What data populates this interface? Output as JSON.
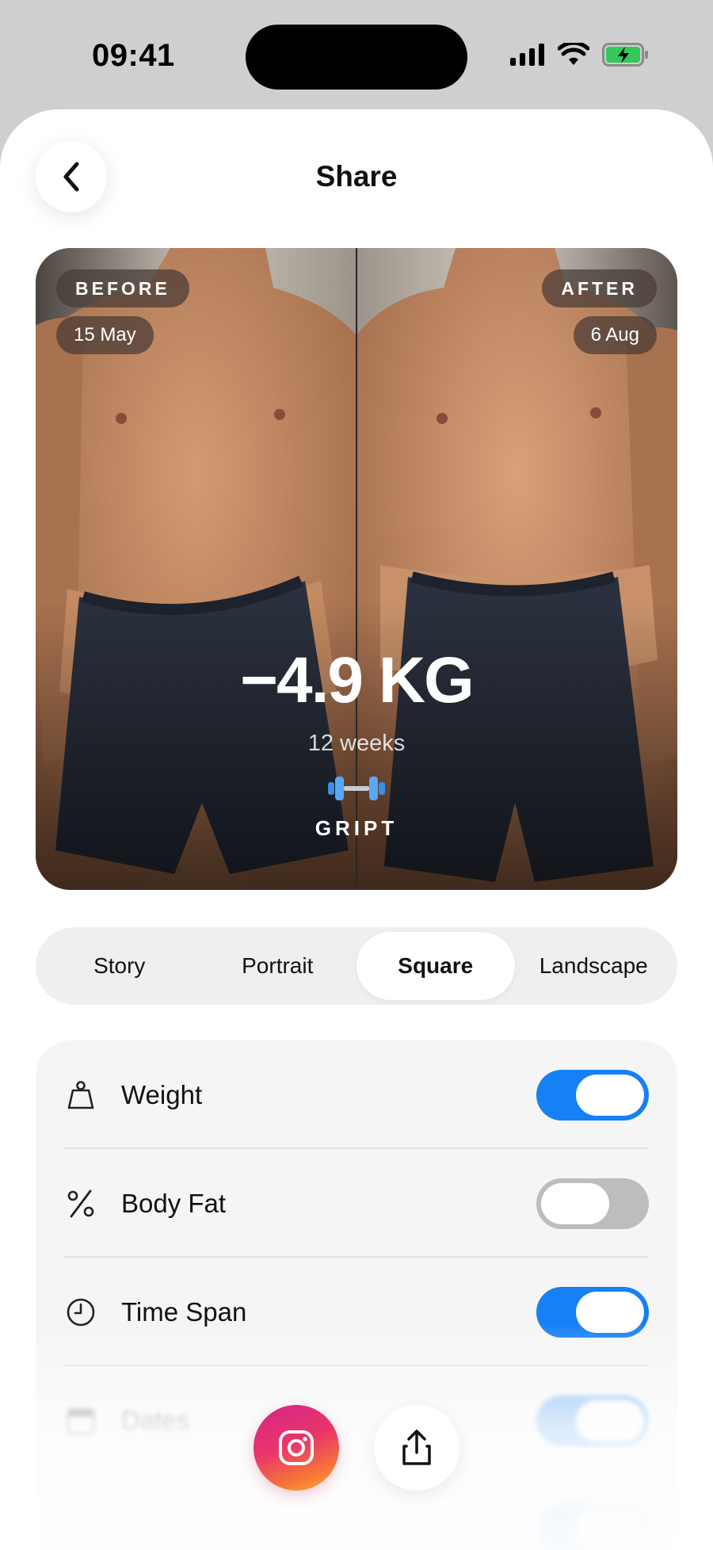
{
  "status_bar": {
    "time": "09:41"
  },
  "nav": {
    "title": "Share"
  },
  "preview": {
    "before_label": "BEFORE",
    "before_date": "15 May",
    "after_label": "AFTER",
    "after_date": "6 Aug",
    "weight_change": "−4.9 KG",
    "duration": "12 weeks",
    "brand": "GRIPT"
  },
  "formats": {
    "selected": "Square",
    "options": [
      {
        "label": "Story"
      },
      {
        "label": "Portrait"
      },
      {
        "label": "Square"
      },
      {
        "label": "Landscape"
      }
    ]
  },
  "settings": {
    "rows": [
      {
        "label": "Weight",
        "icon": "weight-icon",
        "enabled": true
      },
      {
        "label": "Body Fat",
        "icon": "percent-icon",
        "enabled": false
      },
      {
        "label": "Time Span",
        "icon": "clock-icon",
        "enabled": true
      },
      {
        "label": "Dates",
        "icon": "calendar-icon",
        "enabled": true
      }
    ]
  },
  "share": {
    "primary": "instagram-icon",
    "secondary": "share-icon"
  },
  "colors": {
    "accent": "#1680f5",
    "toggle_off": "#bdbdbf"
  }
}
